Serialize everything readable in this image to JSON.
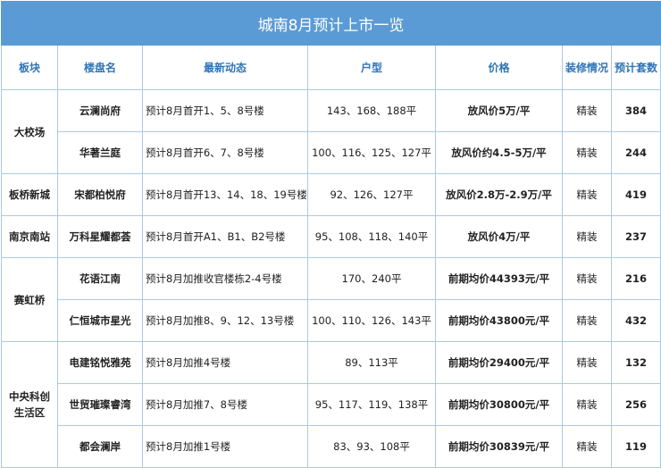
{
  "title": "城南8月预计上市一览",
  "headers": [
    "板块",
    "楼盘名",
    "最新动态",
    "户型",
    "价格",
    "装修情况",
    "预计套数"
  ],
  "blocks": [
    {
      "name": "大校场",
      "rows": [
        {
          "project": "云澜尚府",
          "news": "预计8月首开1、5、8号楼",
          "types": "143、168、188平",
          "price": "放风价5万/平",
          "decoration": "精装",
          "count": "384"
        },
        {
          "project": "华著兰庭",
          "news": "预计8月首开6、7、8号楼",
          "types": "100、116、125、127平",
          "price": "放风价约4.5-5万/平",
          "decoration": "精装",
          "count": "244"
        }
      ]
    },
    {
      "name": "板桥新城",
      "rows": [
        {
          "project": "宋都柏悦府",
          "news": "预计8月首开13、14、18、19号楼",
          "types": "92、126、127平",
          "price": "放风价2.8万-2.9万/平",
          "decoration": "精装",
          "count": "419"
        }
      ]
    },
    {
      "name": "南京南站",
      "rows": [
        {
          "project": "万科星耀都荟",
          "news": "预计8月首开A1、B1、B2号楼",
          "types": "95、108、118、140平",
          "price": "放风价4万/平",
          "decoration": "精装",
          "count": "237"
        }
      ]
    },
    {
      "name": "赛虹桥",
      "rows": [
        {
          "project": "花语江南",
          "news": "预计8月加推收官楼栋2-4号楼",
          "types": "170、240平",
          "price": "前期均价44393元/平",
          "decoration": "精装",
          "count": "216"
        },
        {
          "project": "仁恒城市星光",
          "news": "预计8月加推8、9、12、13号楼",
          "types": "100、110、126、143平",
          "price": "前期均价43800元/平",
          "decoration": "精装",
          "count": "432"
        }
      ]
    },
    {
      "name": "中央科创生活区",
      "rows": [
        {
          "project": "电建铭悦雅苑",
          "news": "预计8月加推4号楼",
          "types": "89、113平",
          "price": "前期均价29400元/平",
          "decoration": "精装",
          "count": "132"
        },
        {
          "project": "世贸璀璨睿湾",
          "news": "预计8月加推7、8号楼",
          "types": "95、117、119、138平",
          "price": "前期均价30800元/平",
          "decoration": "精装",
          "count": "256"
        },
        {
          "project": "都会澜岸",
          "news": "预计8月加推1号楼",
          "types": "83、93、108平",
          "price": "前期均价30839元/平",
          "decoration": "精装",
          "count": "119"
        }
      ]
    }
  ]
}
